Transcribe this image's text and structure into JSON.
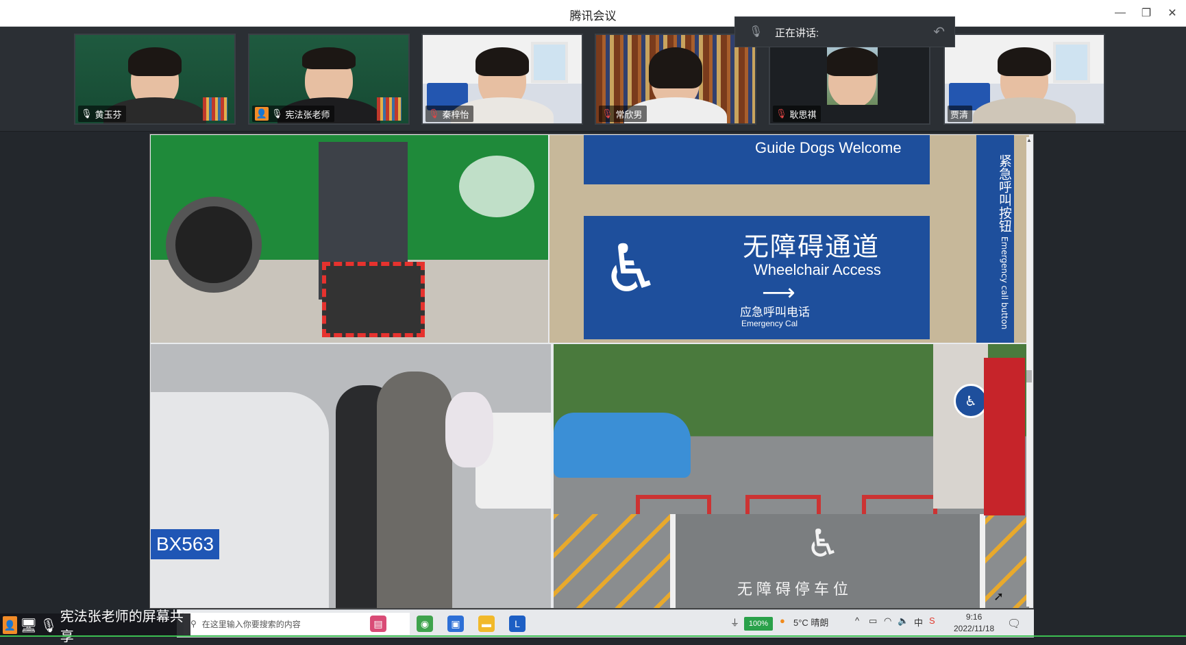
{
  "window": {
    "title": "腾讯会议",
    "minimize": "—",
    "restore": "❐",
    "close": "✕"
  },
  "participants": [
    {
      "name": "黄玉芬",
      "mic": "on"
    },
    {
      "name": "宪法张老师",
      "mic": "on",
      "sharing": true
    },
    {
      "name": "秦梓怡",
      "mic": "off"
    },
    {
      "name": "常欣男",
      "mic": "off"
    },
    {
      "name": "耿思祺",
      "mic": "off"
    },
    {
      "name": "贾清",
      "mic": "none"
    }
  ],
  "speaking_panel": {
    "label": "正在讲话:"
  },
  "shared_screen": {
    "sign_top_text": "Guide Dogs Welcome",
    "sign_zh": "无障碍通道",
    "sign_en": "Wheelchair Access",
    "sign_emergency_zh": "应急呼叫电话",
    "sign_emergency_en": "Emergency Cal",
    "side_sign_zh": "紧急呼叫按钮",
    "side_sign_en": "Emergency call button",
    "plate": "BX563",
    "parking_text": "无障碍停车位"
  },
  "taskbar": {
    "search_placeholder": "在这里输入你要搜索的内容",
    "battery": "100%",
    "weather": "5°C 晴朗",
    "time": "9:16",
    "date": "2022/11/18"
  },
  "share_banner": {
    "text": "宪法张老师的屏幕共享"
  },
  "colors": {
    "accent": "#f28c28",
    "sign_blue": "#1e4f9c",
    "mic_off": "#e04545"
  }
}
